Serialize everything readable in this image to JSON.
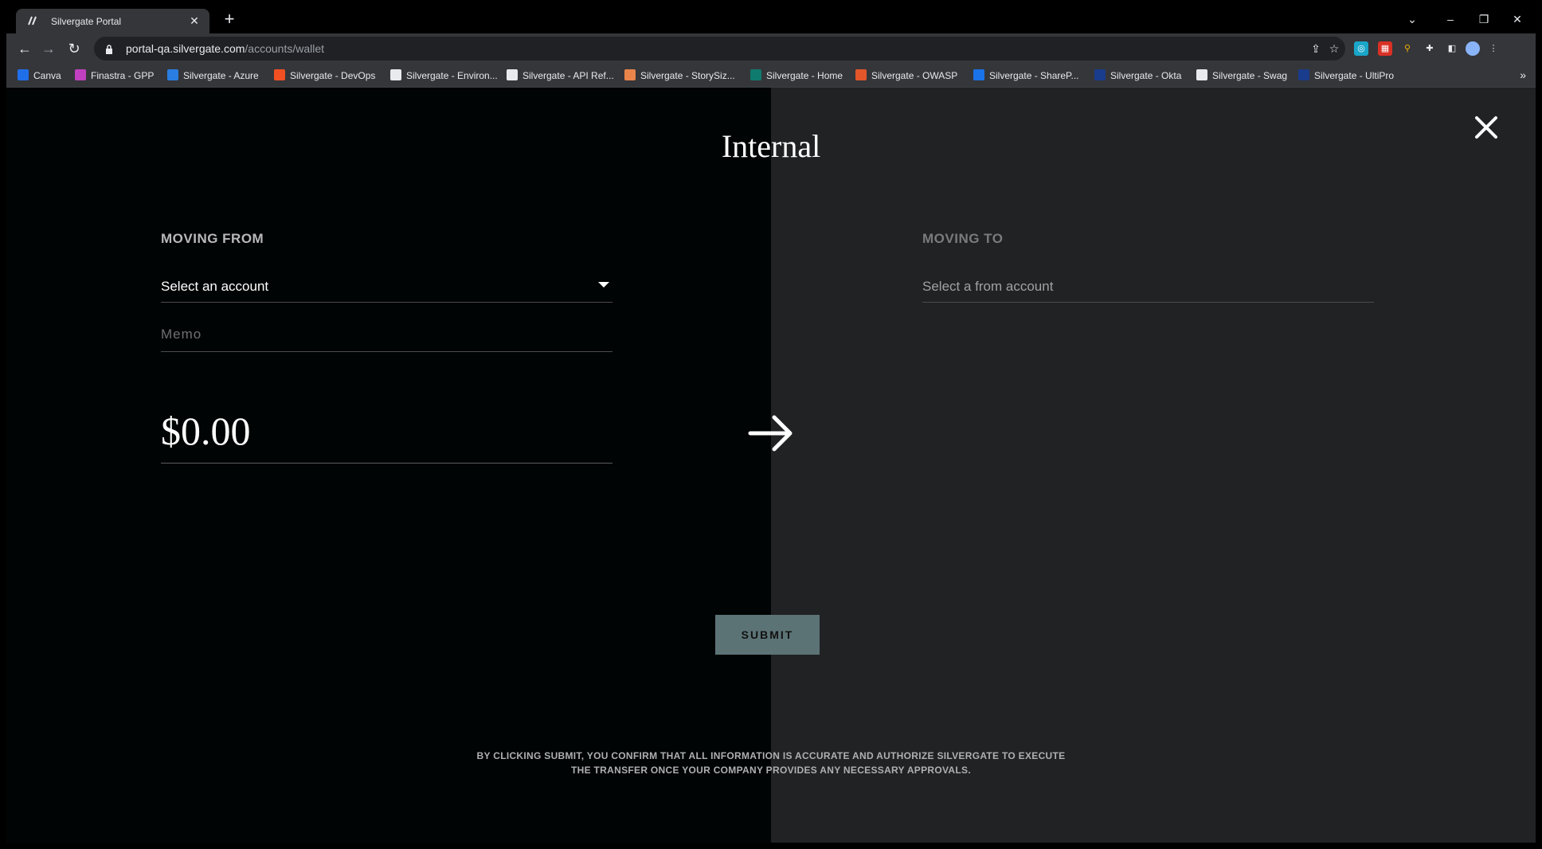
{
  "browser": {
    "tab_title": "Silvergate Portal",
    "url_host": "portal-qa.silvergate.com",
    "url_path": "/accounts/wallet",
    "bookmarks": [
      {
        "label": "Canva",
        "color": "#1f6feb"
      },
      {
        "label": "Finastra - GPP",
        "color": "#c040c0"
      },
      {
        "label": "Silvergate - Azure",
        "color": "#2a7de1"
      },
      {
        "label": "Silvergate - DevOps",
        "color": "#f25022"
      },
      {
        "label": "Silvergate - Environ...",
        "color": "#e8eaed"
      },
      {
        "label": "Silvergate - API Ref...",
        "color": "#e8eaed"
      },
      {
        "label": "Silvergate - StorySiz...",
        "color": "#e9844a"
      },
      {
        "label": "Silvergate - Home",
        "color": "#0f7a6e"
      },
      {
        "label": "Silvergate - OWASP",
        "color": "#e2562a"
      },
      {
        "label": "Silvergate - ShareP...",
        "color": "#1a73e8"
      },
      {
        "label": "Silvergate - Okta",
        "color": "#1a3c8c"
      },
      {
        "label": "Silvergate - Swag",
        "color": "#e8eaed"
      },
      {
        "label": "Silvergate - UltiPro",
        "color": "#1a3c8c"
      }
    ]
  },
  "modal": {
    "title": "Internal",
    "from": {
      "label": "MOVING FROM",
      "select_value": "Select an account",
      "memo_placeholder": "Memo",
      "amount": "$0.00"
    },
    "to": {
      "label": "MOVING TO",
      "select_value": "Select a from account"
    },
    "submit_label": "SUBMIT",
    "disclaimer_line1": "BY CLICKING SUBMIT, YOU CONFIRM THAT ALL INFORMATION IS ACCURATE AND AUTHORIZE SILVERGATE TO EXECUTE",
    "disclaimer_line2": "THE TRANSFER ONCE YOUR COMPANY PROVIDES ANY NECESSARY APPROVALS."
  },
  "colors": {
    "left_pane_bg": "#010404",
    "right_pane_bg": "#212224",
    "submit_bg": "#5c7376"
  }
}
